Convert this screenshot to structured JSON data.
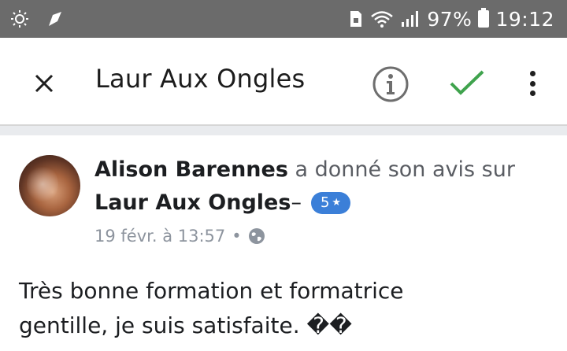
{
  "status_bar": {
    "battery_percent": "97%",
    "time": "19:12",
    "left_icons": [
      "sun-icon",
      "send-icon"
    ],
    "right_icons": [
      "sim-icon",
      "wifi-icon",
      "signal-icon",
      "battery-icon"
    ]
  },
  "app_bar": {
    "title": "Laur Aux Ongles",
    "icons": [
      "close-icon",
      "info-icon",
      "check-icon",
      "more-vert-icon"
    ],
    "check_color": "#3fa34d"
  },
  "post": {
    "author": "Alison Barennes",
    "action": " a donné son avis sur",
    "page_name": "Laur Aux Ongles",
    "dash": " –",
    "rating": "5",
    "rating_star": "★",
    "rating_color": "#3b7fd8",
    "date": "19 févr. à 13:57",
    "separator": "•",
    "privacy_icon": "globe-icon",
    "body_lines": [
      "Très bonne formation et formatrice",
      "gentille, je suis satisfaite. ��"
    ]
  }
}
